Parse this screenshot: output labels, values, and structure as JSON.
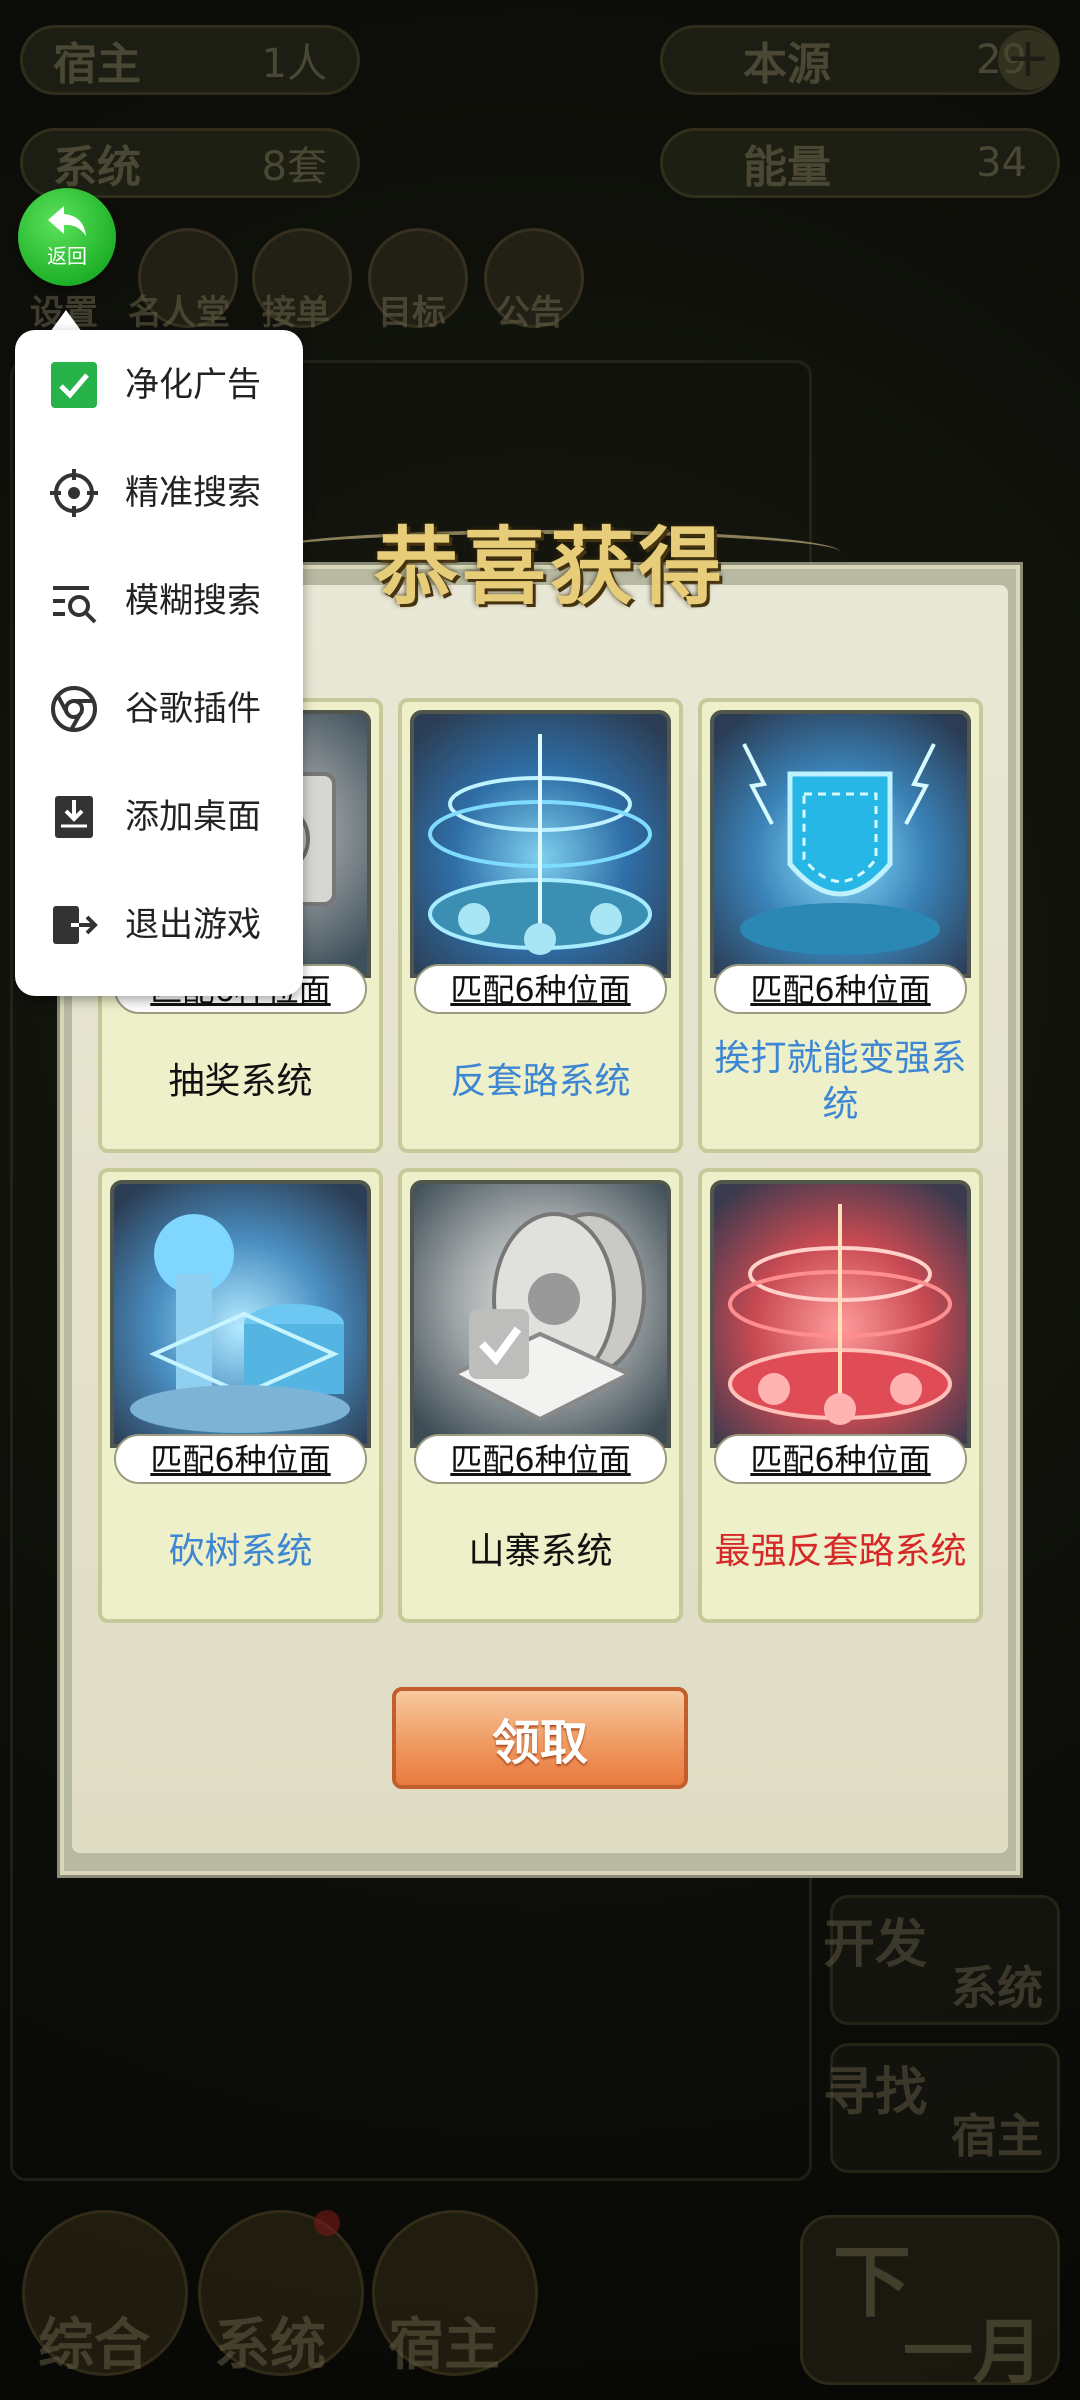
{
  "top_stats": [
    {
      "label": "宿主",
      "value": "1人"
    },
    {
      "label": "系统",
      "value": "8套"
    },
    {
      "label": "本源",
      "value": "29"
    },
    {
      "label": "能量",
      "value": "34"
    }
  ],
  "top_nav": [
    "设置",
    "名人堂",
    "接单",
    "目标",
    "公告"
  ],
  "side_buttons": [
    {
      "line1": "开发",
      "line2": "系统"
    },
    {
      "line1": "寻找",
      "line2": "宿主"
    }
  ],
  "bottom_nav": [
    "综合",
    "系统",
    "宿主"
  ],
  "next_month": {
    "line1": "下",
    "line2": "一月"
  },
  "back_button": {
    "label": "返回",
    "icon": "back-arrow-icon",
    "color": "#22b52c"
  },
  "menu": {
    "items": [
      {
        "label": "净化广告",
        "icon": "checkbox-checked-icon"
      },
      {
        "label": "精准搜索",
        "icon": "crosshair-icon"
      },
      {
        "label": "模糊搜索",
        "icon": "fuzzy-search-icon"
      },
      {
        "label": "谷歌插件",
        "icon": "chrome-icon"
      },
      {
        "label": "添加桌面",
        "icon": "add-desktop-icon"
      },
      {
        "label": "退出游戏",
        "icon": "exit-icon"
      }
    ]
  },
  "modal": {
    "title": "恭喜获得",
    "claim_label": "领取",
    "cards": [
      {
        "subtitle": "匹配6种位面",
        "name": "抽奖系统",
        "name_color": "#111111"
      },
      {
        "subtitle": "匹配6种位面",
        "name": "反套路系统",
        "name_color": "#3d86d4"
      },
      {
        "subtitle": "匹配6种位面",
        "name": "挨打就能变强系统",
        "name_color": "#3d86d4"
      },
      {
        "subtitle": "匹配6种位面",
        "name": "砍树系统",
        "name_color": "#3d86d4"
      },
      {
        "subtitle": "匹配6种位面",
        "name": "山寨系统",
        "name_color": "#111111"
      },
      {
        "subtitle": "匹配6种位面",
        "name": "最强反套路系统",
        "name_color": "#d62828"
      }
    ]
  },
  "colors": {
    "accent_green": "#22b52c",
    "claim_orange": "#f09b62",
    "title_gold": "#e7cd7a"
  }
}
